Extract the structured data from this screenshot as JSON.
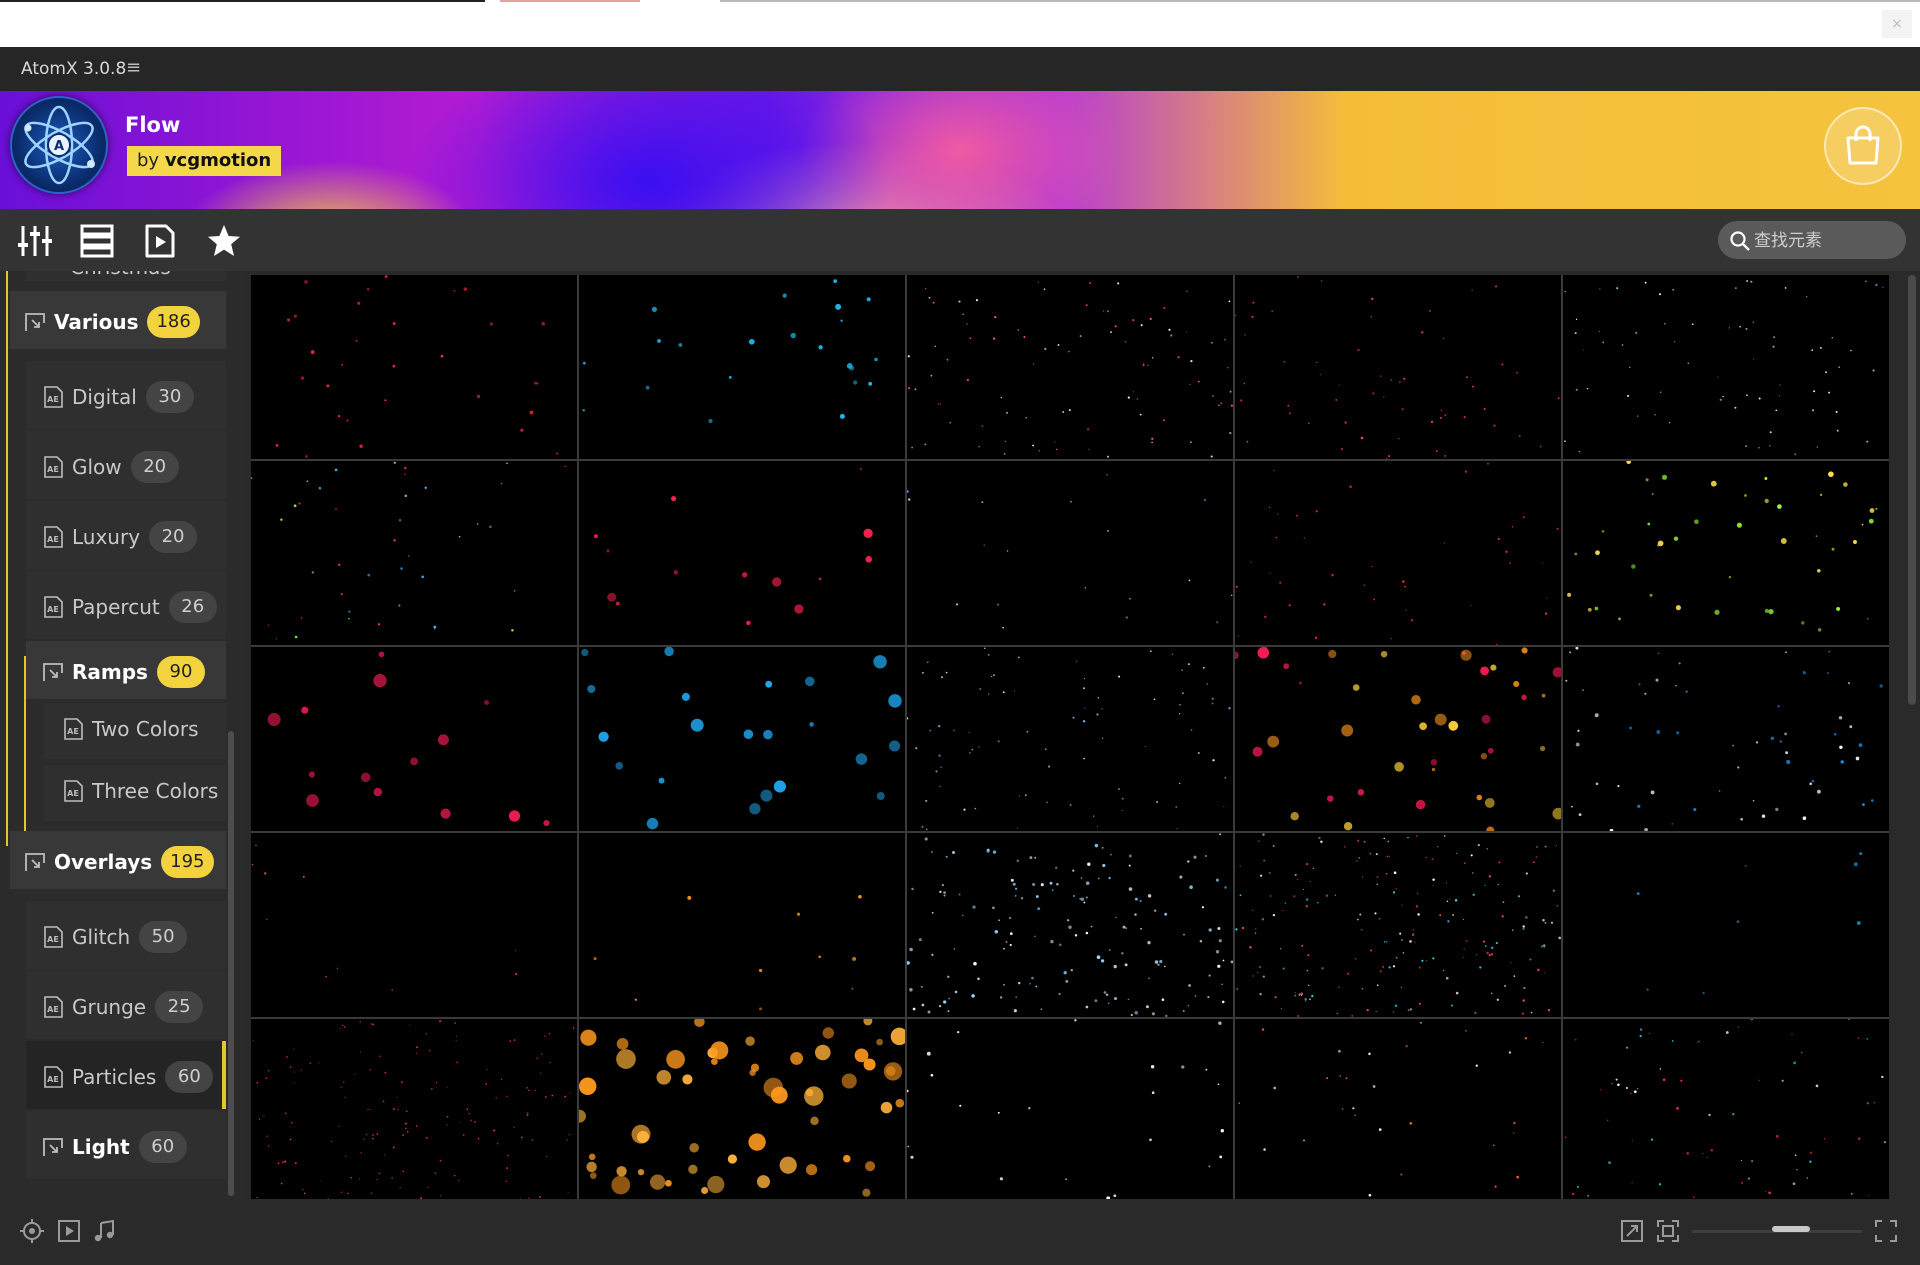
{
  "app": {
    "title": "AtomX 3.0.8",
    "menu_icon": "hamburger-icon",
    "close_glyph": "×"
  },
  "banner": {
    "pack_name": "Flow",
    "author_prefix": "by",
    "author_name": "vcgmotion",
    "logo_letter": "A",
    "store_icon": "shopping-bag-icon"
  },
  "toolbar": {
    "icons": [
      "sliders-icon",
      "list-view-icon",
      "preview-icon",
      "favorites-star-icon"
    ],
    "search": {
      "placeholder": "查找元素",
      "value": ""
    }
  },
  "sidebar": {
    "partial_item": {
      "label": "Christmas"
    },
    "items": [
      {
        "label": "Various",
        "count": "186",
        "level": 1,
        "icon": "folder-link-icon",
        "expanded": true
      },
      {
        "label": "Digital",
        "count": "30",
        "level": 2,
        "icon": "ae-file-icon"
      },
      {
        "label": "Glow",
        "count": "20",
        "level": 2,
        "icon": "ae-file-icon"
      },
      {
        "label": "Luxury",
        "count": "20",
        "level": 2,
        "icon": "ae-file-icon"
      },
      {
        "label": "Papercut",
        "count": "26",
        "level": 2,
        "icon": "ae-file-icon"
      },
      {
        "label": "Ramps",
        "count": "90",
        "level": 2,
        "icon": "folder-link-icon",
        "expanded": true
      },
      {
        "label": "Two Colors",
        "level": 3,
        "icon": "ae-file-icon"
      },
      {
        "label": "Three Colors",
        "level": 3,
        "icon": "ae-file-icon"
      },
      {
        "label": "Overlays",
        "count": "195",
        "level": 1,
        "icon": "folder-link-icon",
        "expanded": true
      },
      {
        "label": "Glitch",
        "count": "50",
        "level": 2,
        "icon": "ae-file-icon"
      },
      {
        "label": "Grunge",
        "count": "25",
        "level": 2,
        "icon": "ae-file-icon"
      },
      {
        "label": "Particles",
        "count": "60",
        "level": 2,
        "icon": "ae-file-icon",
        "active": true
      },
      {
        "label": "Light",
        "count": "60",
        "level": 2,
        "icon": "folder-link-icon"
      }
    ]
  },
  "grid": {
    "thumbnails": [
      {
        "palette": [
          "#ff2a4a"
        ],
        "density": 30,
        "size": [
          1,
          2
        ]
      },
      {
        "palette": [
          "#1fb8e8"
        ],
        "density": 22,
        "size": [
          1,
          3
        ]
      },
      {
        "palette": [
          "#ff5a5a",
          "#ffffff"
        ],
        "density": 90,
        "size": [
          0.6,
          1.2
        ]
      },
      {
        "palette": [
          "#ff4060"
        ],
        "density": 55,
        "size": [
          0.6,
          1.3
        ]
      },
      {
        "palette": [
          "#ffffff",
          "#8fd0ff"
        ],
        "density": 70,
        "size": [
          0.5,
          1.1
        ]
      },
      {
        "palette": [
          "#9cff5a",
          "#ff3060",
          "#4fc0ff"
        ],
        "density": 40,
        "size": [
          0.6,
          1.4
        ]
      },
      {
        "palette": [
          "#ff2050"
        ],
        "density": 14,
        "size": [
          1,
          5
        ]
      },
      {
        "palette": [
          "#4fb0ff",
          "#ffffff"
        ],
        "density": 18,
        "size": [
          0.6,
          1.2
        ]
      },
      {
        "palette": [
          "#ff3050"
        ],
        "density": 40,
        "size": [
          0.6,
          1.3
        ]
      },
      {
        "palette": [
          "#9cff3a",
          "#ffe050"
        ],
        "density": 45,
        "size": [
          0.8,
          3
        ]
      },
      {
        "palette": [
          "#ff1e5a"
        ],
        "density": 14,
        "size": [
          2,
          7
        ]
      },
      {
        "palette": [
          "#1fa8f0"
        ],
        "density": 22,
        "size": [
          2,
          7
        ]
      },
      {
        "palette": [
          "#ffffff",
          "#7fc8ff"
        ],
        "density": 80,
        "size": [
          0.5,
          1.2
        ]
      },
      {
        "palette": [
          "#ff1e5a",
          "#ff9a1e",
          "#ffd23a"
        ],
        "density": 40,
        "size": [
          1.2,
          6
        ]
      },
      {
        "palette": [
          "#1fa0ff",
          "#ffffff"
        ],
        "density": 60,
        "size": [
          0.7,
          2
        ]
      },
      {
        "palette": [
          "#ff5a3a"
        ],
        "density": 10,
        "size": [
          0.6,
          1.2
        ]
      },
      {
        "palette": [
          "#ff9a1e"
        ],
        "density": 10,
        "size": [
          1,
          2
        ]
      },
      {
        "palette": [
          "#ffffff",
          "#9ad8ff"
        ],
        "density": 160,
        "size": [
          0.7,
          1.8
        ]
      },
      {
        "palette": [
          "#ff4a6a",
          "#ffffff",
          "#4ad0ff"
        ],
        "density": 200,
        "size": [
          0.5,
          1.3
        ]
      },
      {
        "palette": [
          "#1a8fd0"
        ],
        "density": 8,
        "size": [
          1,
          2
        ]
      },
      {
        "palette": [
          "#ff3a3a"
        ],
        "density": 150,
        "size": [
          0.5,
          1
        ]
      },
      {
        "palette": [
          "#ff9a1e",
          "#ffb23a"
        ],
        "density": 55,
        "size": [
          3,
          10
        ]
      },
      {
        "palette": [
          "#ffffff"
        ],
        "density": 24,
        "size": [
          0.8,
          2
        ]
      },
      {
        "palette": [
          "#ffffff",
          "#ff6a3a"
        ],
        "density": 30,
        "size": [
          0.6,
          1.4
        ]
      },
      {
        "palette": [
          "#ff2a4a",
          "#ffffff",
          "#4ad0ff"
        ],
        "density": 70,
        "size": [
          0.5,
          1.4
        ]
      }
    ]
  },
  "statusbar": {
    "left_icons": [
      "gear-target-icon",
      "play-icon",
      "music-note-icon"
    ],
    "right_icons": [
      "expand-icon",
      "fit-icon",
      "fullscreen-icon"
    ],
    "thumbnail_size_level": 0.55
  },
  "colors": {
    "accent": "#f2d23d",
    "background": "#2a2a2a"
  }
}
